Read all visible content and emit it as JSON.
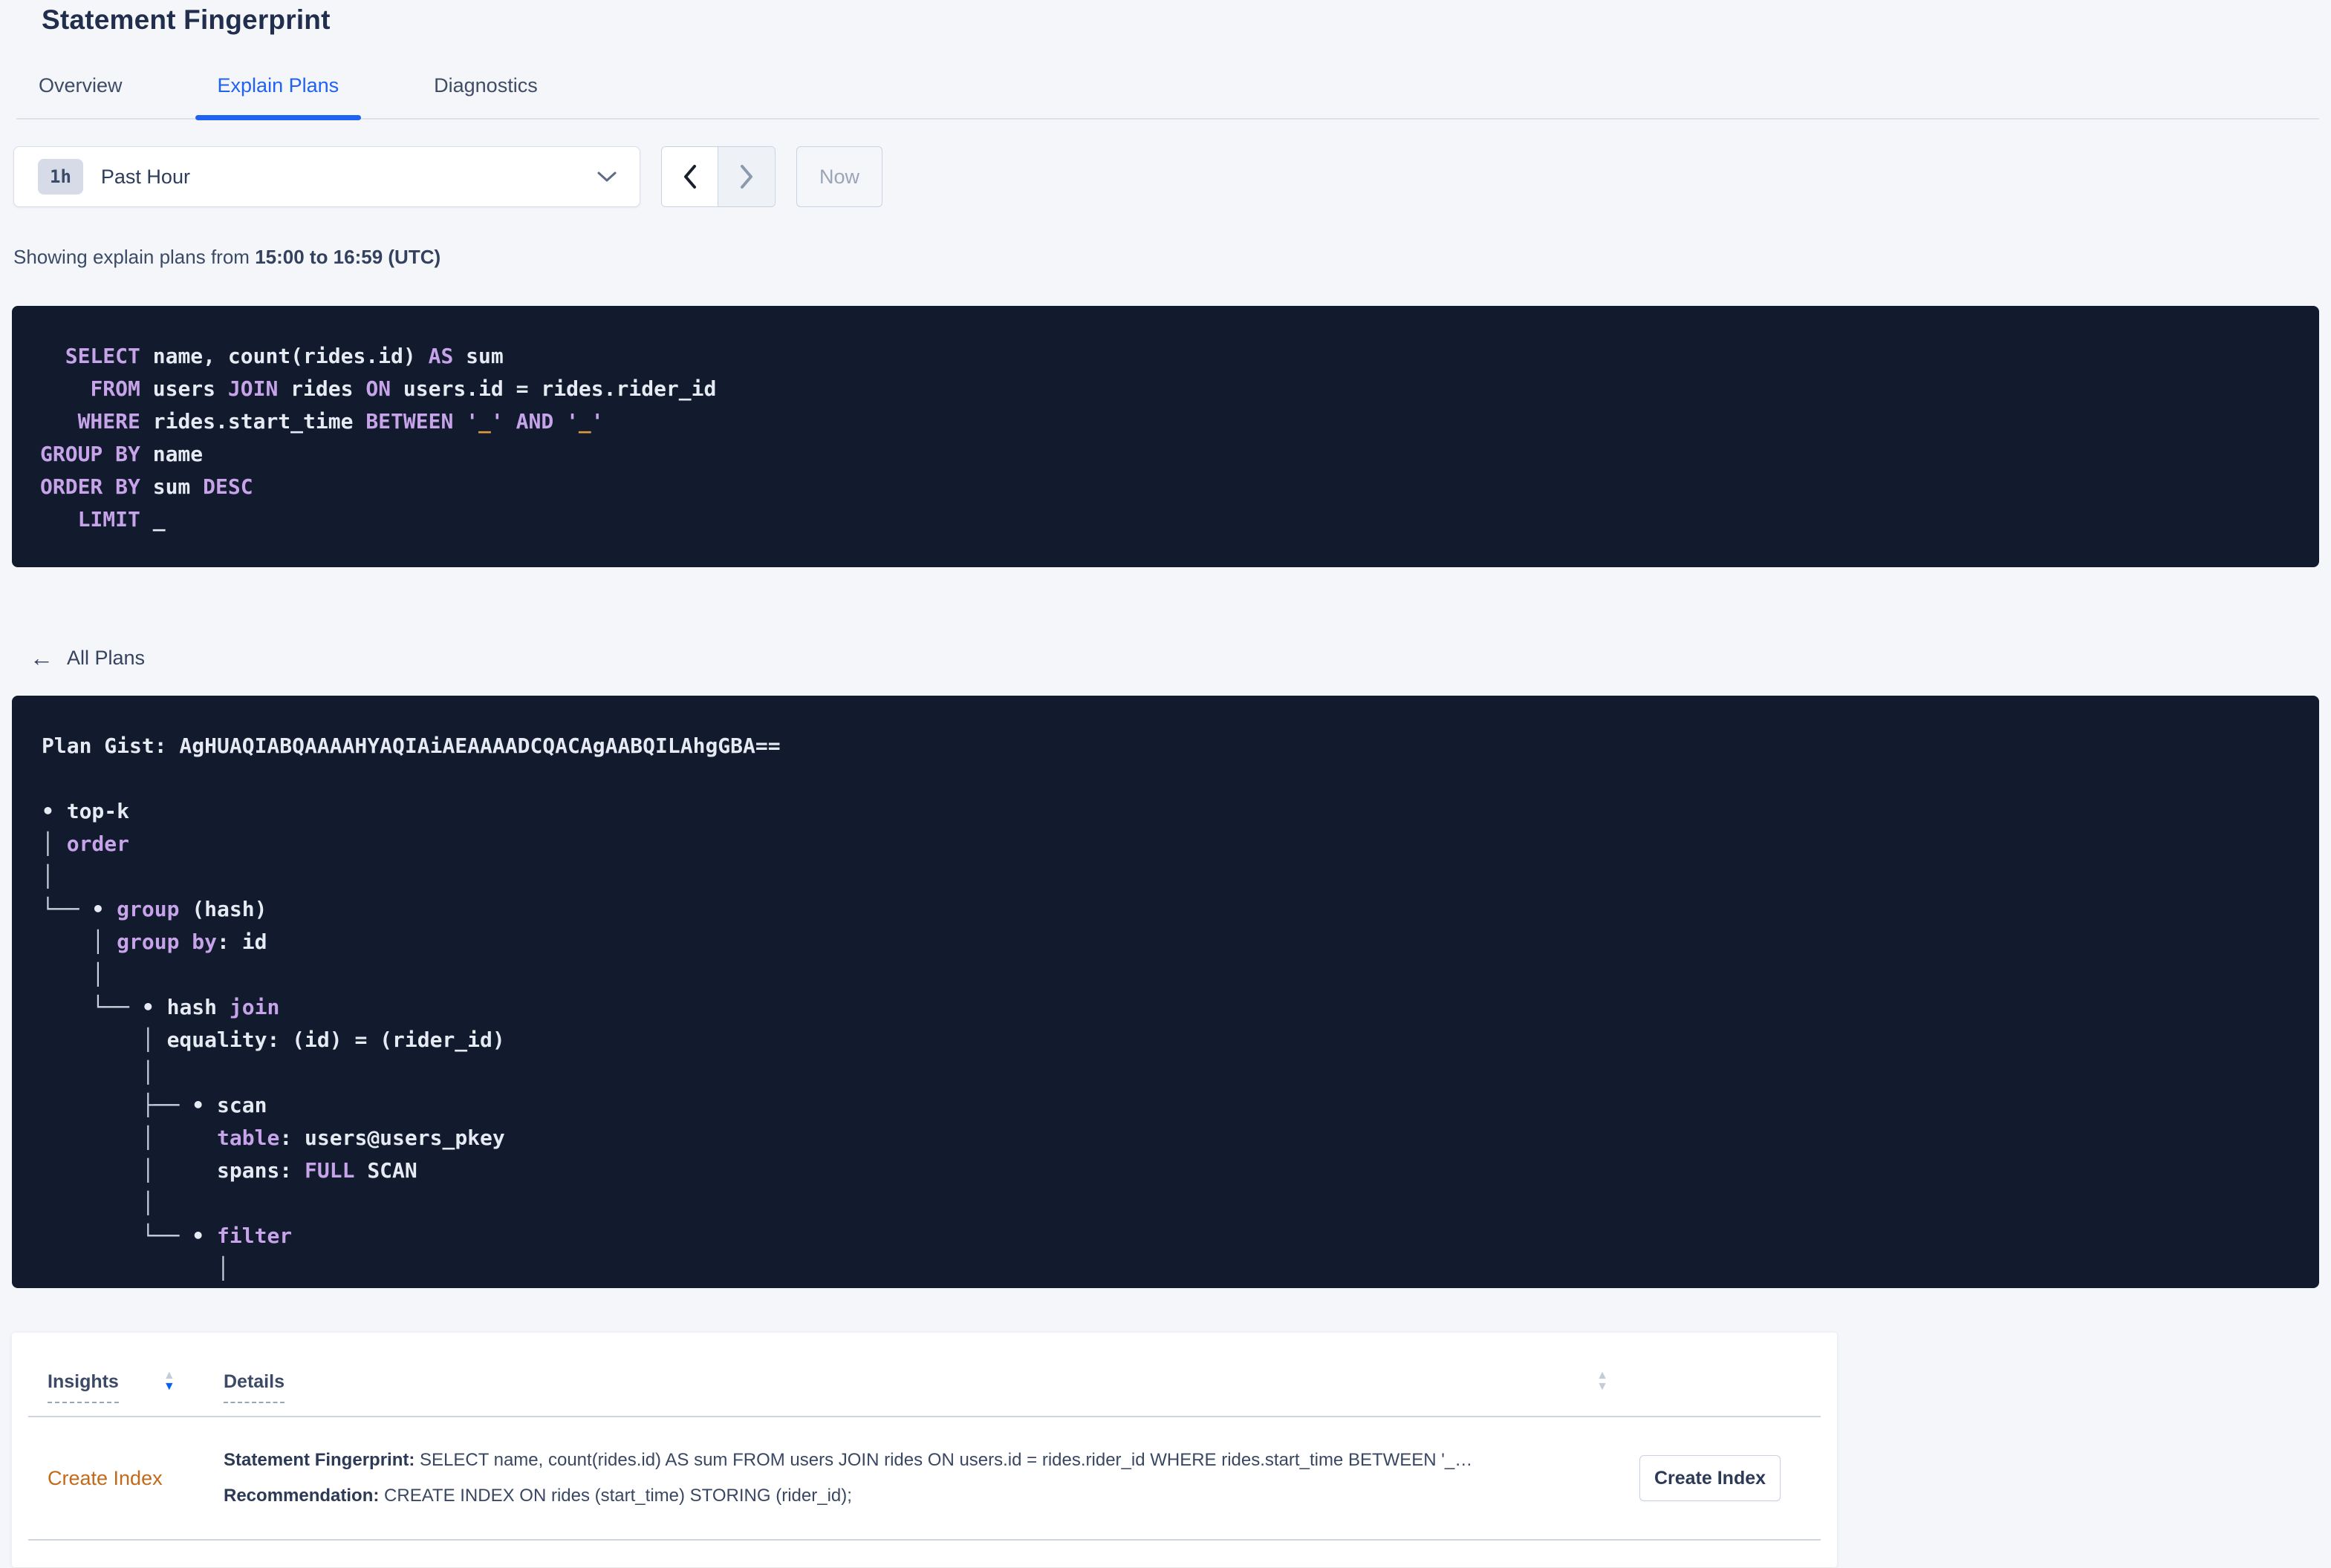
{
  "page_title": "Statement Fingerprint",
  "tabs": [
    {
      "label": "Overview",
      "active": false
    },
    {
      "label": "Explain Plans",
      "active": true
    },
    {
      "label": "Diagnostics",
      "active": false
    }
  ],
  "time_selector": {
    "badge": "1h",
    "label": "Past Hour",
    "now_label": "Now"
  },
  "showing_line": {
    "prefix": "Showing explain plans from ",
    "range_bold": "15:00 to 16:59 (UTC)"
  },
  "icons": {
    "back_arrow": "←",
    "sort_up": "▲",
    "sort_down": "▼"
  },
  "colors": {
    "accent_blue": "#2062f2",
    "sort_active_blue": "#0b5ff0",
    "insight_orange": "#c2691a",
    "code_background": "#121a2e",
    "code_keyword_purple": "#c7a3e9",
    "code_text_white": "#e6ebf3",
    "code_placeholder_orange": "#dd9a3e",
    "page_background": "#f4f6fa"
  },
  "sql": {
    "lines": [
      [
        [
          "w",
          "  "
        ],
        [
          "k",
          "SELECT"
        ],
        [
          "w",
          " name, count(rides.id) "
        ],
        [
          "k",
          "AS"
        ],
        [
          "w",
          " sum"
        ]
      ],
      [
        [
          "w",
          "    "
        ],
        [
          "k",
          "FROM"
        ],
        [
          "w",
          " users "
        ],
        [
          "k",
          "JOIN"
        ],
        [
          "w",
          " rides "
        ],
        [
          "k",
          "ON"
        ],
        [
          "w",
          " users.id = rides.rider_id"
        ]
      ],
      [
        [
          "w",
          "   "
        ],
        [
          "k",
          "WHERE"
        ],
        [
          "w",
          " rides.start_time "
        ],
        [
          "k",
          "BETWEEN"
        ],
        [
          "w",
          " "
        ],
        [
          "k",
          "'"
        ],
        [
          "o",
          "_"
        ],
        [
          "k",
          "'"
        ],
        [
          "w",
          " "
        ],
        [
          "k",
          "AND"
        ],
        [
          "w",
          " "
        ],
        [
          "k",
          "'"
        ],
        [
          "o",
          "_"
        ],
        [
          "k",
          "'"
        ]
      ],
      [
        [
          "k",
          "GROUP BY"
        ],
        [
          "w",
          " name"
        ]
      ],
      [
        [
          "k",
          "ORDER BY"
        ],
        [
          "w",
          " sum "
        ],
        [
          "k",
          "DESC"
        ]
      ],
      [
        [
          "w",
          "   "
        ],
        [
          "k",
          "LIMIT"
        ],
        [
          "w",
          " _"
        ]
      ]
    ]
  },
  "all_plans_label": "All Plans",
  "plan": {
    "gist_label": "Plan Gist: AgHUAQIABQAAAAHYAQIAiAEAAAADCQACAgAABQILAhgGBA==",
    "lines": [
      [
        [
          "w",
          "Plan Gist: AgHUAQIABQAAAAHYAQIAiAEAAAADCQACAgAABQILAhgGBA=="
        ]
      ],
      [],
      [
        [
          "w",
          "• top-k"
        ]
      ],
      [
        [
          "g",
          "│ "
        ],
        [
          "k",
          "order"
        ]
      ],
      [
        [
          "g",
          "│"
        ]
      ],
      [
        [
          "g",
          "└── "
        ],
        [
          "w",
          "• "
        ],
        [
          "k",
          "group"
        ],
        [
          "w",
          " (hash)"
        ]
      ],
      [
        [
          "w",
          "    "
        ],
        [
          "g",
          "│ "
        ],
        [
          "k",
          "group by"
        ],
        [
          "w",
          ": id"
        ]
      ],
      [
        [
          "w",
          "    "
        ],
        [
          "g",
          "│"
        ]
      ],
      [
        [
          "w",
          "    "
        ],
        [
          "g",
          "└── "
        ],
        [
          "w",
          "• hash "
        ],
        [
          "k",
          "join"
        ]
      ],
      [
        [
          "w",
          "        "
        ],
        [
          "g",
          "│ "
        ],
        [
          "w",
          "equality: (id) = (rider_id)"
        ]
      ],
      [
        [
          "w",
          "        "
        ],
        [
          "g",
          "│"
        ]
      ],
      [
        [
          "w",
          "        "
        ],
        [
          "g",
          "├── "
        ],
        [
          "w",
          "• scan"
        ]
      ],
      [
        [
          "w",
          "        "
        ],
        [
          "g",
          "│     "
        ],
        [
          "k",
          "table"
        ],
        [
          "w",
          ": users@users_pkey"
        ]
      ],
      [
        [
          "w",
          "        "
        ],
        [
          "g",
          "│     "
        ],
        [
          "w",
          "spans: "
        ],
        [
          "k",
          "FULL"
        ],
        [
          "w",
          " SCAN"
        ]
      ],
      [
        [
          "w",
          "        "
        ],
        [
          "g",
          "│"
        ]
      ],
      [
        [
          "w",
          "        "
        ],
        [
          "g",
          "└── "
        ],
        [
          "w",
          "• "
        ],
        [
          "k",
          "filter"
        ]
      ],
      [
        [
          "w",
          "              "
        ],
        [
          "g",
          "│"
        ]
      ],
      [
        [
          "w",
          "              "
        ],
        [
          "g",
          "│"
        ]
      ]
    ]
  },
  "insights_table": {
    "columns": [
      {
        "label": "Insights",
        "sort": "desc"
      },
      {
        "label": "Details",
        "sort": "none"
      }
    ],
    "row": {
      "insight_type": "Create Index",
      "fingerprint_label": "Statement Fingerprint:",
      "fingerprint_text": " SELECT name, count(rides.id) AS sum FROM users JOIN rides ON users.id = rides.rider_id WHERE rides.start_time BETWEEN '_…",
      "recommendation_label": "Recommendation:",
      "recommendation_text": " CREATE INDEX ON rides (start_time) STORING (rider_id);",
      "action_label": "Create Index"
    }
  }
}
